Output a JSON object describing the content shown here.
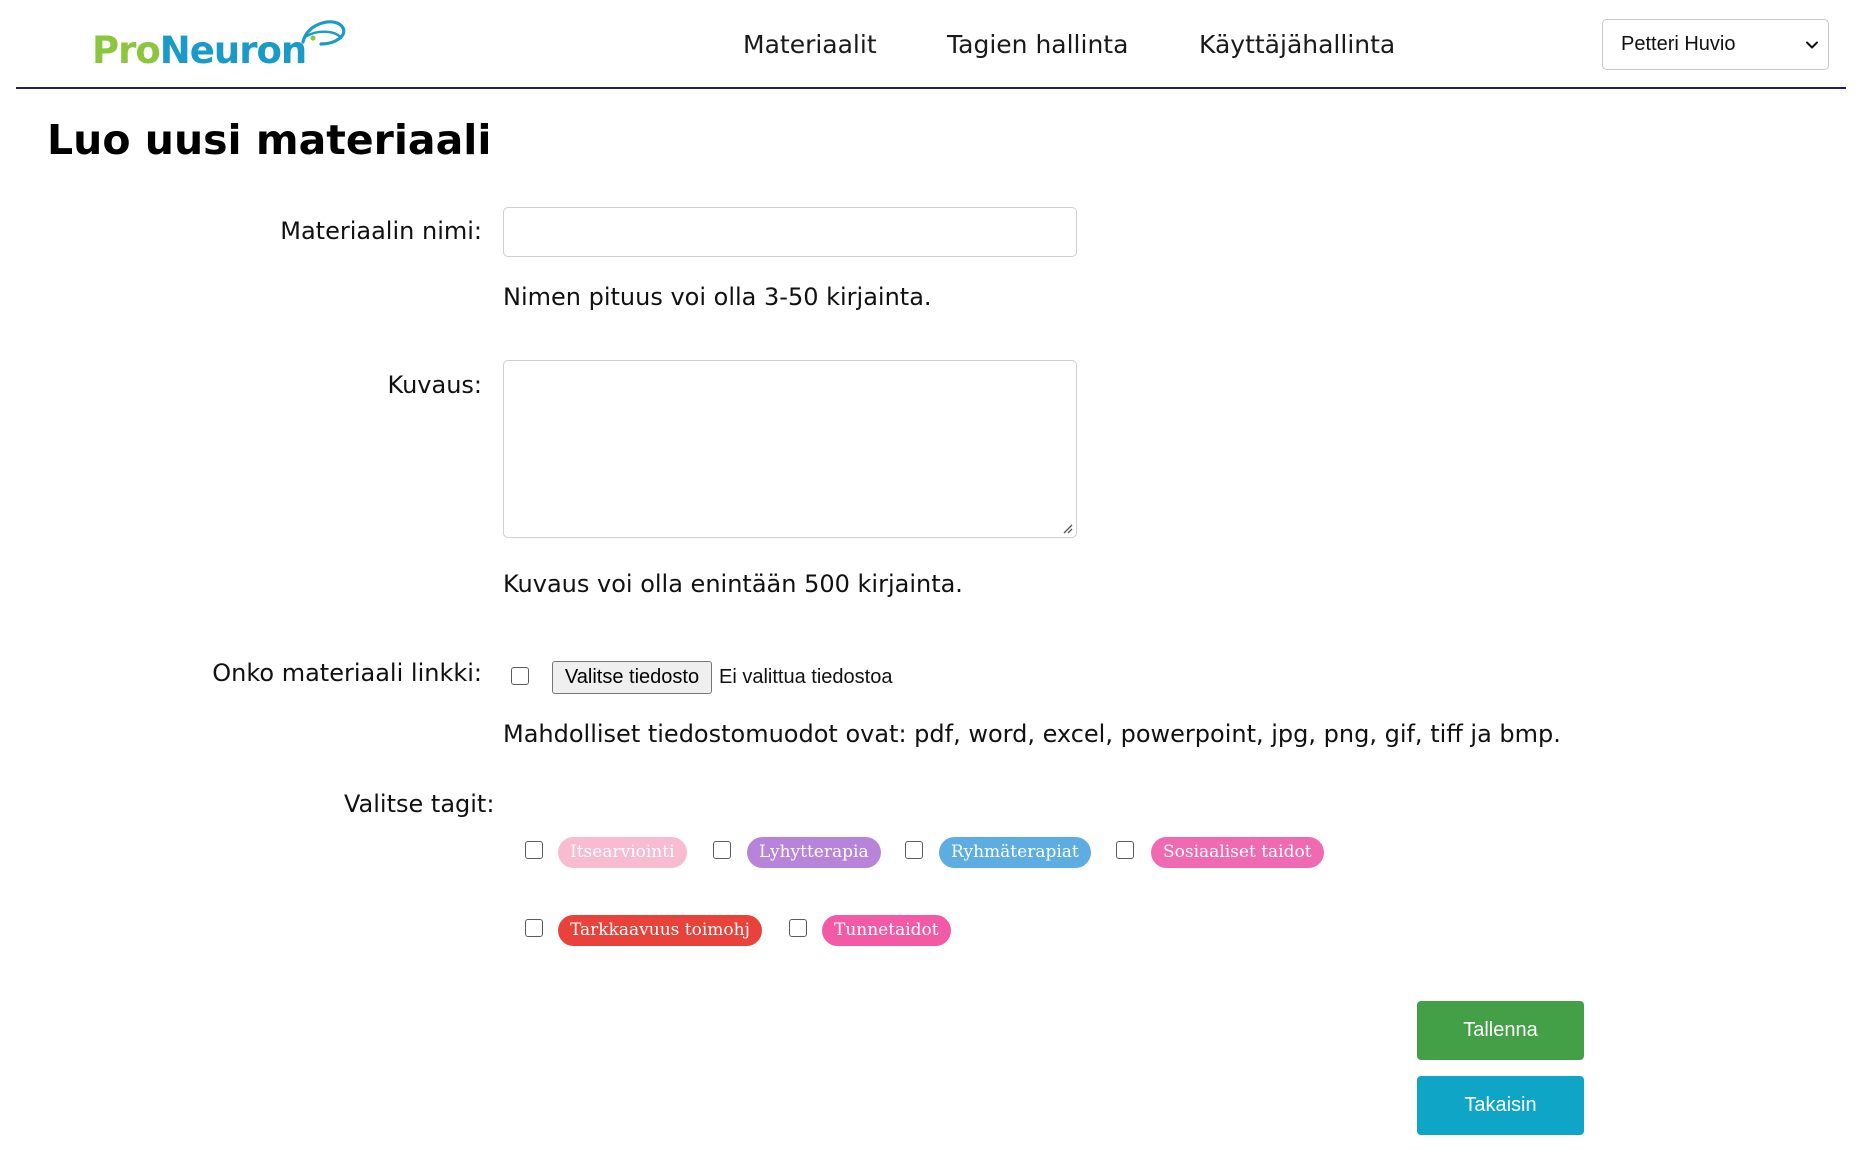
{
  "header": {
    "logo": {
      "part1": "Pro",
      "part2": "Neuron"
    },
    "nav": [
      {
        "label": "Materiaalit"
      },
      {
        "label": "Tagien hallinta"
      },
      {
        "label": "Käyttäjähallinta"
      }
    ],
    "user_select": {
      "value": "Petteri Huvio"
    }
  },
  "page": {
    "title": "Luo uusi materiaali"
  },
  "form": {
    "name": {
      "label": "Materiaalin nimi:",
      "value": "",
      "help": "Nimen pituus voi olla 3-50 kirjainta."
    },
    "description": {
      "label": "Kuvaus:",
      "value": "",
      "help": "Kuvaus voi olla enintään 500 kirjainta."
    },
    "link": {
      "label": "Onko materiaali linkki:",
      "checked": false,
      "file_button": "Valitse tiedosto",
      "file_status": "Ei valittua tiedostoa",
      "help": "Mahdolliset tiedostomuodot ovat: pdf, word, excel, powerpoint, jpg, png, gif, tiff ja bmp."
    },
    "tags": {
      "label": "Valitse tagit:",
      "items": [
        {
          "label": "Itsearviointi",
          "color": "#f8bbd0",
          "checked": false
        },
        {
          "label": "Lyhytterapia",
          "color": "#b784d9",
          "checked": false
        },
        {
          "label": "Ryhmäterapiat",
          "color": "#5dade2",
          "checked": false
        },
        {
          "label": "Sosiaaliset taidot",
          "color": "#f06ab2",
          "checked": false
        },
        {
          "label": "Tarkkaavuus toimohj",
          "color": "#e8423a",
          "checked": false
        },
        {
          "label": "Tunnetaidot",
          "color": "#f25aa6",
          "checked": false
        }
      ]
    },
    "actions": {
      "save": "Tallenna",
      "back": "Takaisin"
    }
  },
  "colors": {
    "header_line": "#1c1a7a",
    "logo_green": "#8cc63f",
    "logo_blue": "#1a9ac6",
    "save": "#43a047",
    "back": "#0ea5c6"
  }
}
